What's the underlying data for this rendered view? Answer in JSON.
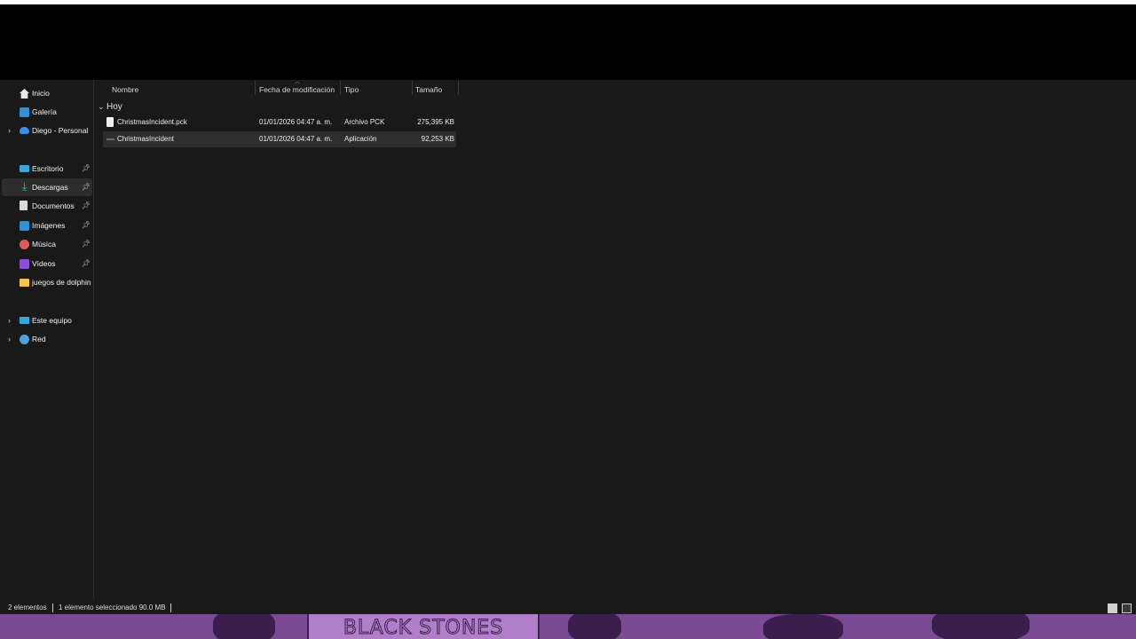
{
  "sidebar": {
    "items": [
      {
        "label": "Inicio",
        "icon": "home-icon"
      },
      {
        "label": "Galería",
        "icon": "gallery-icon"
      },
      {
        "label": "Diego - Personal",
        "icon": "onedrive-cloud-icon"
      },
      {
        "label": "Escritorio",
        "icon": "desktop-icon"
      },
      {
        "label": "Descargas",
        "icon": "download-icon"
      },
      {
        "label": "Documentos",
        "icon": "document-icon"
      },
      {
        "label": "Imágenes",
        "icon": "images-icon"
      },
      {
        "label": "Música",
        "icon": "music-icon"
      },
      {
        "label": "Vídeos",
        "icon": "videos-icon"
      },
      {
        "label": "juegos de dolphin",
        "icon": "folder-icon"
      },
      {
        "label": "Este equipo",
        "icon": "computer-icon"
      },
      {
        "label": "Red",
        "icon": "network-icon"
      }
    ],
    "selected": "Descargas"
  },
  "columns": {
    "name": "Nombre",
    "modified": "Fecha de modificación",
    "type": "Tipo",
    "size": "Tamaño"
  },
  "group": {
    "label": "Hoy"
  },
  "files": [
    {
      "name": "ChristmasIncident.pck",
      "modified": "01/01/2026 04:47 a. m.",
      "type": "Archivo PCK",
      "size": "275,395 KB"
    },
    {
      "name": "ChristmasIncident",
      "modified": "01/01/2026 04:47 a. m.",
      "type": "Aplicación",
      "size": "92,253 KB"
    }
  ],
  "statusbar": {
    "count": "2 elementos",
    "selection": "1 elemento seleccionado  90.0 MB"
  },
  "wallpaper": {
    "text": "BLACK STONES"
  },
  "colors": {
    "background": "#191919",
    "selected_row": "#2e2e2e",
    "wallpaper_purple": "#7a4b93"
  }
}
